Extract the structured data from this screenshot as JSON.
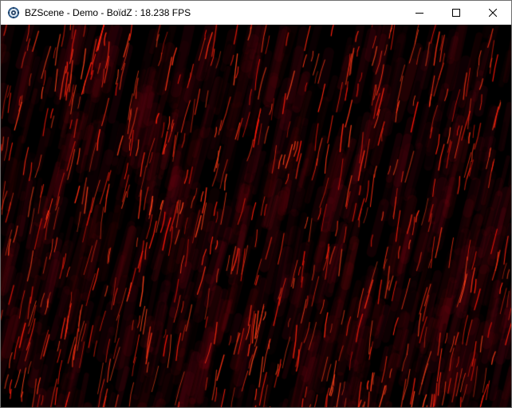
{
  "window": {
    "title": "BZScene - Demo - BoïdZ : 18.238 FPS",
    "icon": "app-gear-icon"
  },
  "caption_buttons": {
    "minimize_icon": "minimize-icon",
    "maximize_icon": "maximize-icon",
    "close_icon": "close-icon"
  },
  "scene": {
    "background_color": "#000000",
    "streak_color": "#ff2a1a",
    "glow_color": "#7a0612"
  }
}
